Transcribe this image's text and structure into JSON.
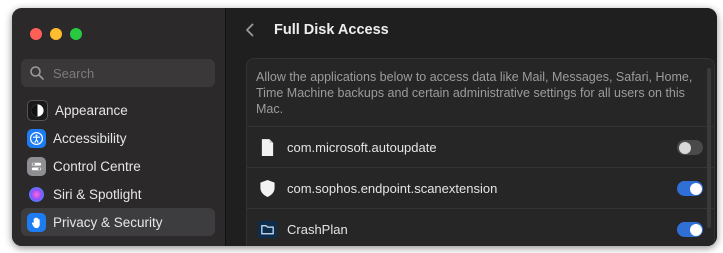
{
  "window": {
    "traffic_lights": {
      "close": "#ff5f57",
      "minimize": "#febc2e",
      "zoom": "#28c840"
    }
  },
  "sidebar": {
    "search": {
      "placeholder": "Search",
      "icon": "search-icon"
    },
    "items": [
      {
        "label": "Appearance",
        "icon": "appearance-icon",
        "color": "#1a1a1a",
        "active": false
      },
      {
        "label": "Accessibility",
        "icon": "accessibility-icon",
        "color": "#1e7cf2",
        "active": false
      },
      {
        "label": "Control Centre",
        "icon": "control-centre-icon",
        "color": "#8e8e93",
        "active": false
      },
      {
        "label": "Siri & Spotlight",
        "icon": "siri-icon",
        "color": "#b34fd8",
        "active": false
      },
      {
        "label": "Privacy & Security",
        "icon": "hand-icon",
        "color": "#1e7cf2",
        "active": true
      }
    ]
  },
  "main": {
    "title": "Full Disk Access",
    "description": "Allow the applications below to access data like Mail, Messages, Safari, Home, Time Machine backups and certain administrative settings for all users on this Mac.",
    "apps": [
      {
        "name": "com.microsoft.autoupdate",
        "icon": "document-icon",
        "enabled": false
      },
      {
        "name": "com.sophos.endpoint.scanextension",
        "icon": "shield-icon",
        "enabled": true
      },
      {
        "name": "CrashPlan",
        "icon": "folder-icon",
        "enabled": true
      }
    ]
  },
  "colors": {
    "accent": "#2f6fd6",
    "sidebar_bg": "#2b2929",
    "main_bg": "#1f1f1f"
  }
}
